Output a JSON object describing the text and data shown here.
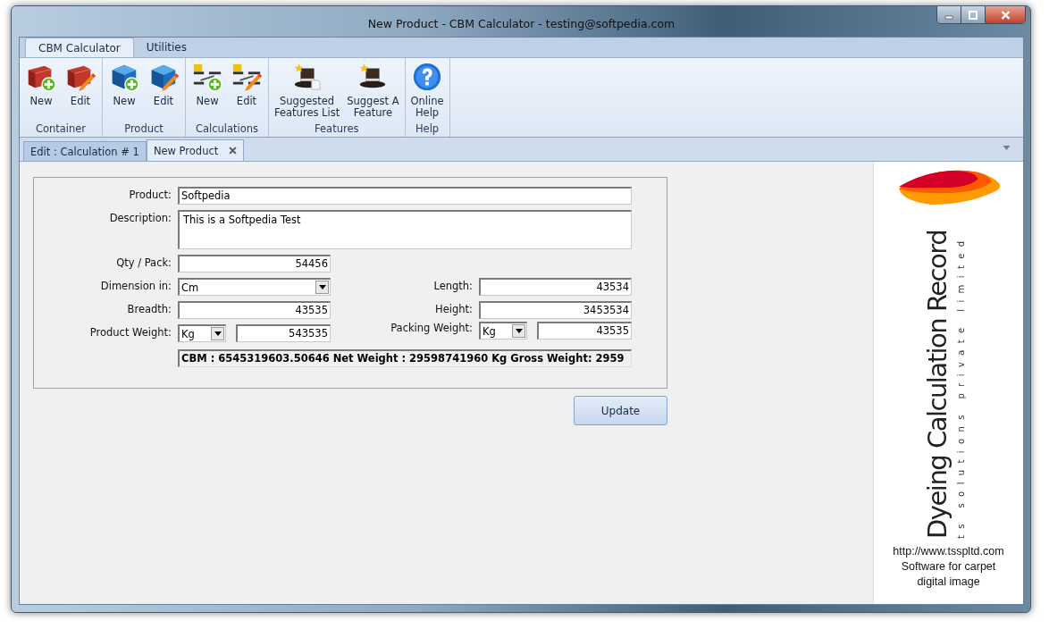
{
  "window": {
    "title": "New Product - CBM Calculator - testing@softpedia.com"
  },
  "ribbon": {
    "tabs": [
      {
        "label": "CBM Calculator",
        "selected": true
      },
      {
        "label": "Utilities",
        "selected": false
      }
    ],
    "groups": [
      {
        "label": "Container",
        "buttons": [
          {
            "label": "New"
          },
          {
            "label": "Edit"
          }
        ]
      },
      {
        "label": "Product",
        "buttons": [
          {
            "label": "New"
          },
          {
            "label": "Edit"
          }
        ]
      },
      {
        "label": "Calculations",
        "buttons": [
          {
            "label": "New"
          },
          {
            "label": "Edit"
          }
        ]
      },
      {
        "label": "Features",
        "buttons": [
          {
            "label": "Suggested\nFeatures List"
          },
          {
            "label": "Suggest A\nFeature"
          }
        ]
      },
      {
        "label": "Help",
        "buttons": [
          {
            "label": "Online\nHelp"
          }
        ]
      }
    ]
  },
  "doc_tabs": [
    {
      "label": "Edit : Calculation # 1",
      "selected": false
    },
    {
      "label": "New Product",
      "selected": true
    }
  ],
  "form": {
    "product": {
      "label": "Product:",
      "value": "Softpedia"
    },
    "description": {
      "label": "Description:",
      "value": "This is a Softpedia Test"
    },
    "qty_pack": {
      "label": "Qty / Pack:",
      "value": "54456"
    },
    "dimension": {
      "label": "Dimension in:",
      "value": "Cm"
    },
    "length": {
      "label": "Length:",
      "value": "43534"
    },
    "breadth": {
      "label": "Breadth:",
      "value": "43535"
    },
    "height": {
      "label": "Height:",
      "value": "3453534"
    },
    "product_weight": {
      "label": "Product Weight:",
      "unit": "Kg",
      "value": "543535"
    },
    "packing_weight": {
      "label": "Packing Weight:",
      "unit": "Kg",
      "value": "43535"
    },
    "summary": "CBM : 6545319603.50646  Net Weight : 29598741960 Kg  Gross Weight: 2959"
  },
  "update_button": "Update",
  "ad": {
    "headline": "Dyeing Calculation Record",
    "tagline": "ts solutions private limited",
    "lines": [
      "http://www.tsspltd.com",
      "Software for carpet",
      "digital image"
    ]
  }
}
